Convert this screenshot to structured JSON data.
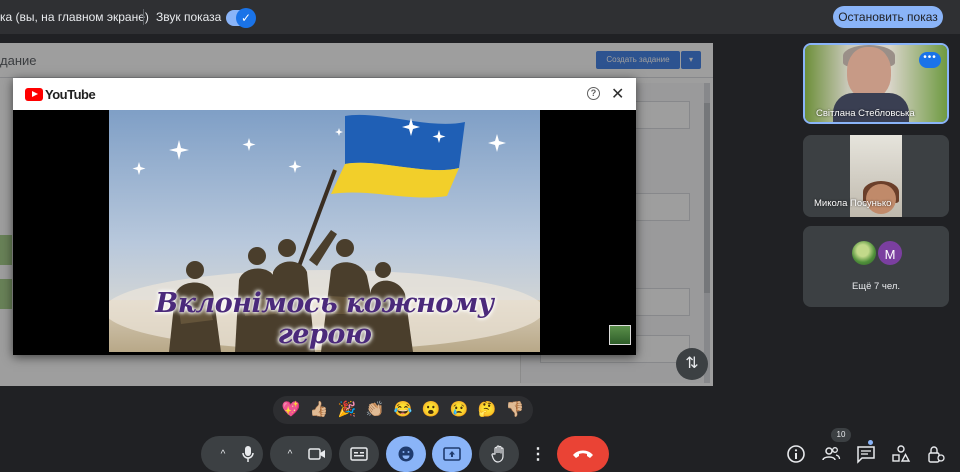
{
  "topbar": {
    "presenting_text": "ка (вы, на главном экране)",
    "sound_label": "Звук показа",
    "sound_enabled": true,
    "stop_button": "Остановить показ"
  },
  "shared_screen": {
    "doc_title": "дание",
    "create_button": "Создать задание",
    "create_dropdown": "▾"
  },
  "youtube_popup": {
    "brand": "YouTube",
    "help_symbol": "?",
    "close_symbol": "✕",
    "video_caption": "Вклонімось кожному герою"
  },
  "swap_button": "⇅",
  "participants": [
    {
      "name": "Світлана Стебловська",
      "more": "•••"
    },
    {
      "name": "Микола Посунько"
    },
    {
      "avatar_letter": "M",
      "more_text": "Ещё 7 чел."
    }
  ],
  "reactions": [
    "💖",
    "👍🏼",
    "🎉",
    "👏🏼",
    "😂",
    "😮",
    "😢",
    "🤔",
    "👎🏼"
  ],
  "controls": {
    "caret": "^",
    "more_options": "⋮"
  },
  "people_count": "10",
  "colors": {
    "accent": "#8ab4f8",
    "accent_dark": "#1a73e8",
    "end_call": "#ea4335",
    "control_bg": "#3c4043",
    "background": "#202124",
    "youtube_red": "#ff0000",
    "caption_purple": "#4b2a7b"
  }
}
